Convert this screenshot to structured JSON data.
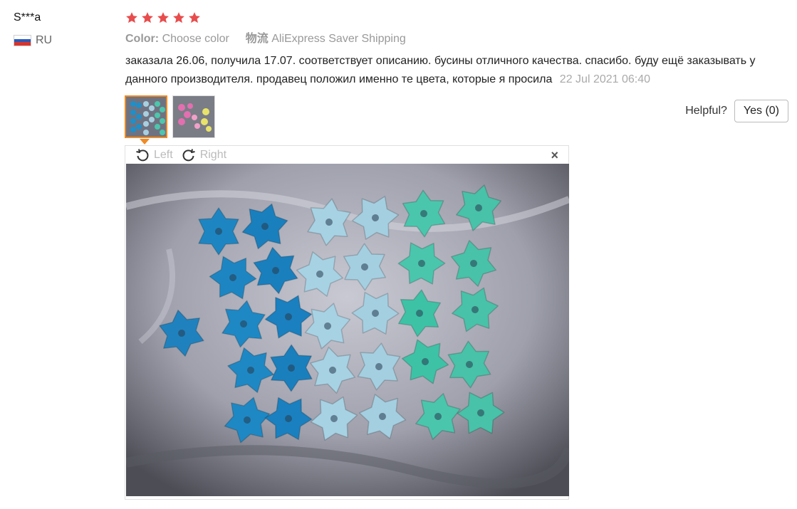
{
  "reviewer": {
    "name": "S***a",
    "country": "RU",
    "flag_colors": [
      "#ffffff",
      "#2a5ab8",
      "#d8342c"
    ]
  },
  "review": {
    "rating": 5,
    "star_color": "#e84c4c",
    "color_label": "Color:",
    "color_value": "Choose color",
    "shipping_label": "物流",
    "shipping_value": "AliExpress Saver Shipping",
    "text": "заказала 26.06, получила 17.07. соответствует описанию. бусины отличного качества. спасибо. буду ещё заказывать у данного производителя. продавец положил именно те цвета, которые я просила",
    "date": "22 Jul 2021 06:40"
  },
  "helpful": {
    "label": "Helpful?",
    "yes_label": "Yes (0)"
  },
  "viewer": {
    "rotate_left_label": "Left",
    "rotate_right_label": "Right",
    "close_label": "×",
    "accent_color": "#f08a24"
  }
}
